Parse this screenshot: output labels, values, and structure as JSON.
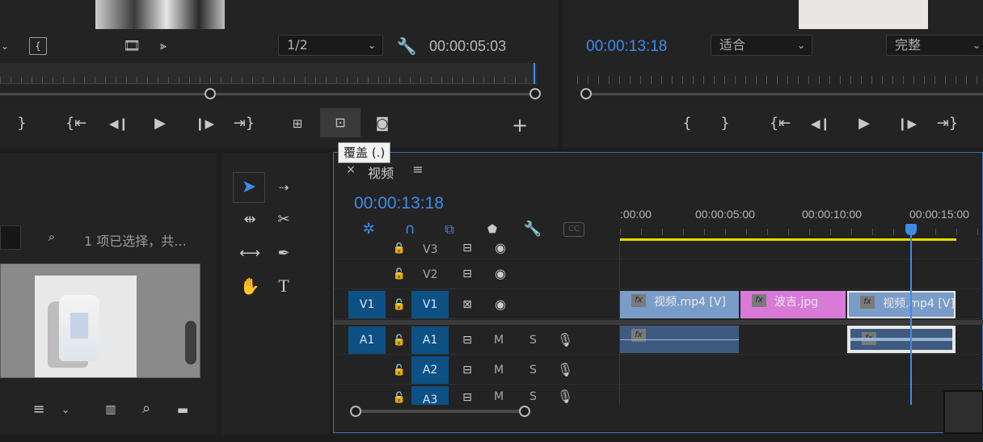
{
  "source_monitor": {
    "resolution": "1/2",
    "timecode": "00:00:05:03"
  },
  "program_monitor": {
    "timecode": "00:00:13:18",
    "fit": "适合",
    "quality": "完整"
  },
  "tooltip": "覆盖 (.)",
  "project": {
    "status": "1 项已选择，共..."
  },
  "timeline": {
    "tab_label": "视频",
    "timecode": "00:00:13:18",
    "ruler": [
      ":00:00",
      "00:00:05:00",
      "00:00:10:00",
      "00:00:15:00"
    ],
    "tracks": {
      "v3": "V3",
      "v2": "V2",
      "v1": "V1",
      "v1_src": "V1",
      "a1": "A1",
      "a1_src": "A1",
      "a2": "A2",
      "a3": "A3"
    },
    "mute_label": "M",
    "solo_label": "S",
    "clips": {
      "v1_clip1": "视频.mp4 [V]",
      "v1_clip2": "波吉.jpg",
      "v1_clip3": "视频.mp4 [V]",
      "fx": "fx"
    }
  },
  "colors": {
    "accent_blue": "#3d8be8",
    "track_blue": "#0d5084",
    "clip_video": "#7a9cc8",
    "clip_image": "#d97ad8",
    "clip_audio": "#3e5a7f",
    "work_area": "#e8dc00"
  }
}
